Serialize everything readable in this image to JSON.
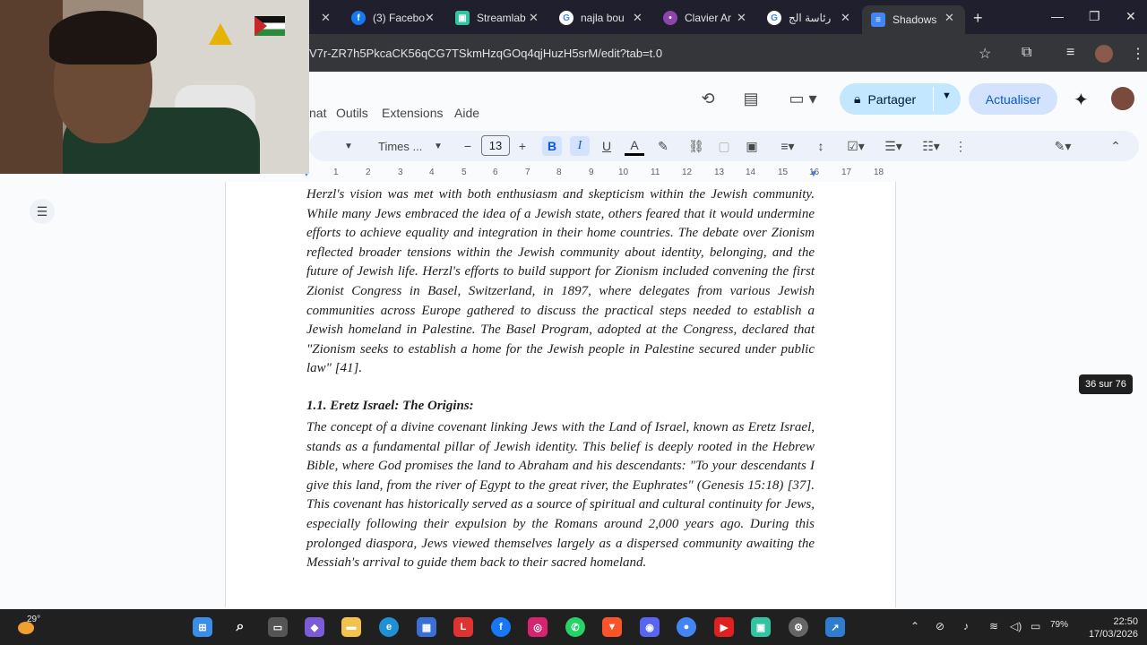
{
  "browser": {
    "tabs": [
      {
        "label": "(3) Facebo",
        "icon": "facebook-icon",
        "color": "#1877f2"
      },
      {
        "label": "Streamlab",
        "icon": "streamlabs-icon",
        "color": "#31c3a2"
      },
      {
        "label": "najla bou",
        "icon": "google-icon",
        "color": "#4285f4"
      },
      {
        "label": "Clavier Ar",
        "icon": "pin-icon",
        "color": "#8e44ad"
      },
      {
        "label": "رئاسة الج",
        "icon": "google-icon",
        "color": "#4285f4"
      },
      {
        "label": "Shadows",
        "icon": "docs-icon",
        "color": "#4285f4"
      }
    ],
    "url": "V7r-ZR7h5PkcaCK56qCG7TSkmHzqGOq4qjHuzH5srM/edit?tab=t.0"
  },
  "docs": {
    "menu": [
      "nat",
      "Outils",
      "Extensions",
      "Aide"
    ],
    "share_label": "Partager",
    "update_label": "Actualiser",
    "font_name": "Times ...",
    "font_size": "13",
    "page_indicator": "36 sur 76",
    "ruler": [
      "1",
      "2",
      "3",
      "4",
      "5",
      "6",
      "7",
      "8",
      "9",
      "10",
      "11",
      "12",
      "13",
      "14",
      "15",
      "16",
      "17",
      "18"
    ]
  },
  "document": {
    "paragraph1": "Herzl's vision was met with both enthusiasm and skepticism within the Jewish community. While many Jews embraced the idea of a Jewish state, others feared that it would undermine efforts to achieve equality and integration in their home countries. The debate over Zionism reflected broader tensions within the Jewish community about identity, belonging, and the future of Jewish life. Herzl's efforts to build support for Zionism included convening the first Zionist Congress in Basel, Switzerland, in 1897, where delegates from various Jewish communities across Europe gathered to discuss the practical steps needed to establish a Jewish homeland in Palestine. The Basel Program, adopted at the Congress, declared that \"Zionism seeks to establish a home for the Jewish people in Palestine secured under public law\" [41].",
    "heading": "1.1. Eretz Israel: The Origins:",
    "paragraph2": "The concept of a divine covenant linking Jews with the Land of Israel, known as Eretz Israel, stands as a fundamental pillar of Jewish identity. This belief is deeply rooted in the Hebrew Bible, where God promises the land to Abraham and his descendants: \"To your descendants I give this land, from the river of Egypt to the great river, the Euphrates\" (Genesis 15:18) [37]. This covenant has historically served as a source of spiritual and cultural continuity for Jews, especially following their expulsion by the Romans around 2,000 years ago. During this prolonged diaspora, Jews viewed themselves largely as a dispersed community awaiting the Messiah's arrival to guide them back to their sacred homeland."
  },
  "taskbar": {
    "weather": "29°",
    "battery": "79%",
    "time": "22:50",
    "date": "17/03/2026"
  }
}
